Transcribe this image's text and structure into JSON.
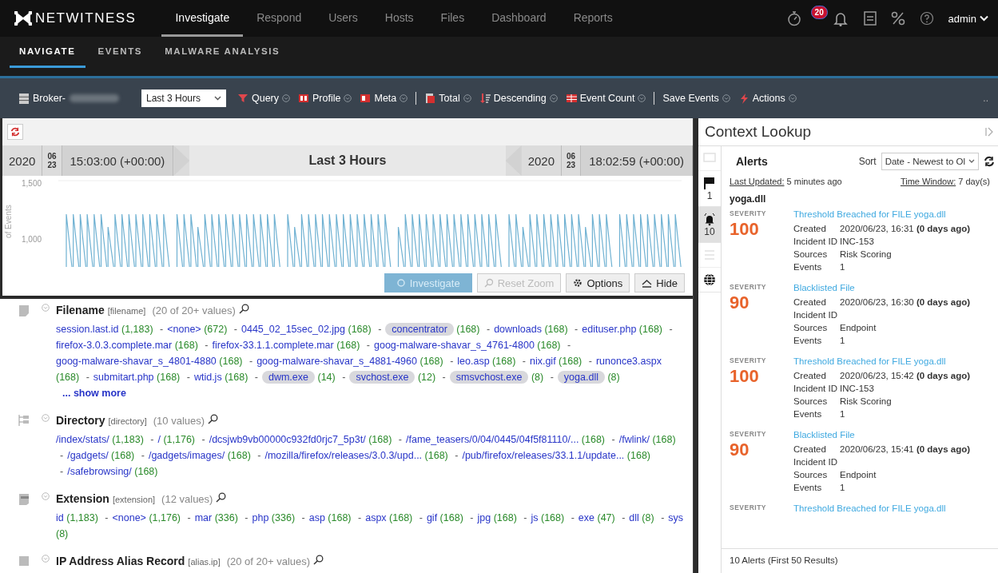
{
  "app": {
    "logo": "NETWITNESS",
    "nav": [
      {
        "label": "Investigate",
        "selected": true
      },
      {
        "label": "Respond",
        "selected": false
      },
      {
        "label": "Users",
        "selected": false
      },
      {
        "label": "Hosts",
        "selected": false
      },
      {
        "label": "Files",
        "selected": false
      },
      {
        "label": "Dashboard",
        "selected": false
      },
      {
        "label": "Reports",
        "selected": false
      }
    ],
    "notifications": "20",
    "user": "admin"
  },
  "subnav": [
    {
      "label": "NAVIGATE",
      "selected": true
    },
    {
      "label": "EVENTS",
      "selected": false
    },
    {
      "label": "MALWARE ANALYSIS",
      "selected": false
    }
  ],
  "toolbar": {
    "service": "Broker-",
    "time_range": "Last 3 Hours",
    "items": [
      {
        "kind": "query",
        "label": "Query"
      },
      {
        "kind": "profile",
        "label": "Profile"
      },
      {
        "kind": "meta",
        "label": "Meta"
      },
      {
        "kind": "separator"
      },
      {
        "kind": "total",
        "label": "Total"
      },
      {
        "kind": "descending",
        "label": "Descending"
      },
      {
        "kind": "event-count",
        "label": "Event Count"
      },
      {
        "kind": "separator"
      },
      {
        "kind": "save",
        "label": "Save Events"
      },
      {
        "kind": "actions",
        "label": "Actions"
      }
    ],
    "more": ".."
  },
  "timeline": {
    "start": {
      "year": "2020",
      "month": "06",
      "day": "23",
      "time": "15:03:00 (+00:00)"
    },
    "label": "Last 3 Hours",
    "end": {
      "year": "2020",
      "month": "06",
      "day": "23",
      "time": "18:02:59 (+00:00)"
    }
  },
  "chart": {
    "ytick_labels": [
      "1,500",
      "1,000"
    ],
    "ylabel": "of Events",
    "buttons": [
      {
        "kind": "investigate",
        "label": "Investigate",
        "disabled": true
      },
      {
        "kind": "reset",
        "label": "Reset Zoom",
        "disabled": true
      },
      {
        "kind": "options",
        "label": "Options",
        "disabled": false
      },
      {
        "kind": "hide",
        "label": "Hide",
        "disabled": false
      }
    ]
  },
  "meta_groups": [
    {
      "kind": "filename",
      "name": "Filename",
      "key": "[filename]",
      "count": "(20 of 20+ values)",
      "values": [
        {
          "text": "session.last.id",
          "count": "(1,183)",
          "highlighted": false
        },
        {
          "text": "<none>",
          "count": "(672)",
          "highlighted": false
        },
        {
          "text": "0445_02_15sec_02.jpg",
          "count": "(168)",
          "highlighted": false
        },
        {
          "text": "concentrator",
          "count": "(168)",
          "highlighted": true
        },
        {
          "text": "downloads",
          "count": "(168)",
          "highlighted": false
        },
        {
          "text": "edituser.php",
          "count": "(168)",
          "highlighted": false
        },
        {
          "text": "firefox-3.0.3.complete.mar",
          "count": "(168)",
          "highlighted": false
        },
        {
          "text": "firefox-33.1.1.complete.mar",
          "count": "(168)",
          "highlighted": false
        },
        {
          "text": "goog-malware-shavar_s_4761-4800",
          "count": "(168)",
          "highlighted": false
        },
        {
          "text": "goog-malware-shavar_s_4801-4880",
          "count": "(168)",
          "highlighted": false
        },
        {
          "text": "goog-malware-shavar_s_4881-4960",
          "count": "(168)",
          "highlighted": false
        },
        {
          "text": "leo.asp",
          "count": "(168)",
          "highlighted": false
        },
        {
          "text": "nix.gif",
          "count": "(168)",
          "highlighted": false
        },
        {
          "text": "runonce3.aspx",
          "count": "(168)",
          "highlighted": false
        },
        {
          "text": "submitart.php",
          "count": "(168)",
          "highlighted": false
        },
        {
          "text": "wtid.js",
          "count": "(168)",
          "highlighted": false
        },
        {
          "text": "dwm.exe",
          "count": "(14)",
          "highlighted": true
        },
        {
          "text": "svchost.exe",
          "count": "(12)",
          "highlighted": true
        },
        {
          "text": "smsvchost.exe",
          "count": "(8)",
          "highlighted": true
        },
        {
          "text": "yoga.dll",
          "count": "(8)",
          "highlighted": true
        }
      ],
      "separator": "-",
      "show_more": "... show more"
    },
    {
      "kind": "directory",
      "name": "Directory",
      "key": "[directory]",
      "count": "(10 values)",
      "values": [
        {
          "text": "/index/stats/",
          "count": "(1,183)",
          "highlighted": false
        },
        {
          "text": "/",
          "count": "(1,176)",
          "highlighted": false
        },
        {
          "text": "/dcsjwb9vb00000c932fd0rjc7_5p3t/",
          "count": "(168)",
          "highlighted": false
        },
        {
          "text": "/fame_teasers/0/04/0445/04f5f81110/...",
          "count": "(168)",
          "highlighted": false
        },
        {
          "text": "/fwlink/",
          "count": "(168)",
          "highlighted": false
        },
        {
          "text": "/gadgets/",
          "count": "(168)",
          "highlighted": false
        },
        {
          "text": "/gadgets/images/",
          "count": "(168)",
          "highlighted": false
        },
        {
          "text": "/mozilla/firefox/releases/3.0.3/upd...",
          "count": "(168)",
          "highlighted": false
        },
        {
          "text": "/pub/firefox/releases/33.1.1/update...",
          "count": "(168)",
          "highlighted": false
        },
        {
          "text": "/safebrowsing/",
          "count": "(168)",
          "highlighted": false
        }
      ],
      "separator": "-"
    },
    {
      "kind": "extension",
      "name": "Extension",
      "key": "[extension]",
      "count": "(12 values)",
      "values": [
        {
          "text": "id",
          "count": "(1,183)",
          "highlighted": false
        },
        {
          "text": "<none>",
          "count": "(1,176)",
          "highlighted": false
        },
        {
          "text": "mar",
          "count": "(336)",
          "highlighted": false
        },
        {
          "text": "php",
          "count": "(336)",
          "highlighted": false
        },
        {
          "text": "asp",
          "count": "(168)",
          "highlighted": false
        },
        {
          "text": "aspx",
          "count": "(168)",
          "highlighted": false
        },
        {
          "text": "gif",
          "count": "(168)",
          "highlighted": false
        },
        {
          "text": "jpg",
          "count": "(168)",
          "highlighted": false
        },
        {
          "text": "js",
          "count": "(168)",
          "highlighted": false
        },
        {
          "text": "exe",
          "count": "(47)",
          "highlighted": false
        },
        {
          "text": "dll",
          "count": "(8)",
          "highlighted": false
        },
        {
          "text": "sys",
          "count": "(8)",
          "highlighted": false
        }
      ],
      "separator": "-"
    },
    {
      "kind": "alias",
      "name": "IP Address Alias Record",
      "key": "[alias.ip]",
      "count": "(20 of 20+ values)"
    }
  ],
  "context": {
    "title": "Context Lookup",
    "tabs": [
      {
        "kind": "message",
        "disabled": true,
        "selected": false
      },
      {
        "kind": "flag",
        "count": "1",
        "disabled": false,
        "selected": false
      },
      {
        "kind": "bell",
        "count": "10",
        "disabled": false,
        "selected": true
      },
      {
        "kind": "list",
        "disabled": true,
        "selected": false
      },
      {
        "kind": "globe",
        "disabled": false,
        "selected": false
      }
    ],
    "panel": "Alerts",
    "sort_label": "Sort",
    "sort_value": "Date - Newest to Ol",
    "last_updated_label": "Last Updated:",
    "last_updated": "5 minutes ago",
    "window_label": "Time Window:",
    "window": "7 day(s)",
    "entity": "yoga.dll",
    "alerts": [
      {
        "severity_label": "SEVERITY",
        "severity": "100",
        "title": "Threshold Breached for FILE yoga.dll",
        "fields": [
          {
            "label": "Created",
            "value": "2020/06/23, 16:31 **(0 days ago)**"
          },
          {
            "label": "Incident ID",
            "value": "INC-153"
          },
          {
            "label": "Sources",
            "value": "Risk Scoring"
          },
          {
            "label": "Events",
            "value": "1"
          }
        ]
      },
      {
        "severity_label": "SEVERITY",
        "severity": "90",
        "title": "Blacklisted File",
        "fields": [
          {
            "label": "Created",
            "value": "2020/06/23, 16:30 **(0 days ago)**"
          },
          {
            "label": "Incident ID"
          },
          {
            "label": "Sources",
            "value": "Endpoint"
          },
          {
            "label": "Events",
            "value": "1"
          }
        ]
      },
      {
        "severity_label": "SEVERITY",
        "severity": "100",
        "title": "Threshold Breached for FILE yoga.dll",
        "fields": [
          {
            "label": "Created",
            "value": "2020/06/23, 15:42 **(0 days ago)**"
          },
          {
            "label": "Incident ID",
            "value": "INC-153"
          },
          {
            "label": "Sources",
            "value": "Risk Scoring"
          },
          {
            "label": "Events",
            "value": "1"
          }
        ]
      },
      {
        "severity_label": "SEVERITY",
        "severity": "90",
        "title": "Blacklisted File",
        "fields": [
          {
            "label": "Created",
            "value": "2020/06/23, 15:41 **(0 days ago)**"
          },
          {
            "label": "Incident ID"
          },
          {
            "label": "Sources",
            "value": "Endpoint"
          },
          {
            "label": "Events",
            "value": "1"
          }
        ]
      },
      {
        "severity_label": "SEVERITY",
        "title": "Threshold Breached for FILE yoga.dll"
      }
    ],
    "footer": "10 Alerts (First 50 Results)"
  }
}
